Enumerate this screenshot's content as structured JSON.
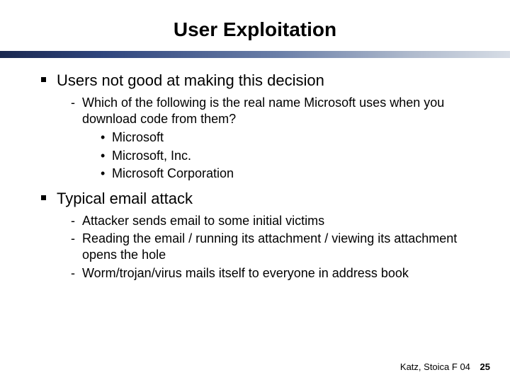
{
  "title": "User Exploitation",
  "bullets": [
    {
      "text": "Users not good at making this decision",
      "sub": [
        {
          "text": "Which of the following is the real name Microsoft uses when you download code from them?",
          "sub": [
            {
              "text": "Microsoft"
            },
            {
              "text": "Microsoft, Inc."
            },
            {
              "text": "Microsoft Corporation"
            }
          ]
        }
      ]
    },
    {
      "text": "Typical email attack",
      "sub": [
        {
          "text": "Attacker sends email to some initial victims"
        },
        {
          "text": "Reading the email / running its attachment / viewing its attachment opens the hole"
        },
        {
          "text": "Worm/trojan/virus mails itself to everyone in address book"
        }
      ]
    }
  ],
  "footer": {
    "credit": "Katz, Stoica F 04",
    "page": "25"
  }
}
